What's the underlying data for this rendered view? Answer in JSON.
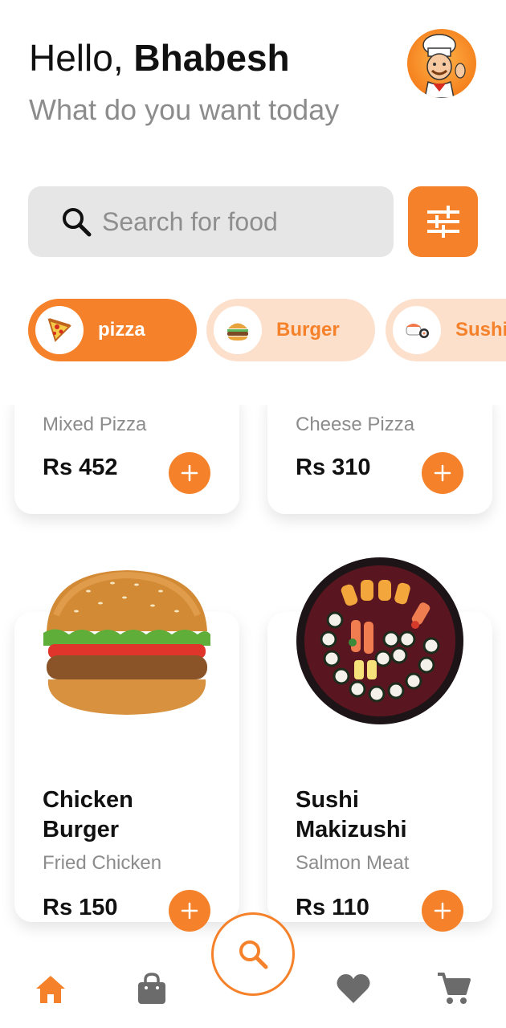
{
  "header": {
    "greeting": "Hello,",
    "user_name": "Bhabesh",
    "subtitle": "What do you want today"
  },
  "avatar": {
    "icon": "chef-avatar"
  },
  "search": {
    "placeholder": "Search for food",
    "icon": "search-icon"
  },
  "filter": {
    "icon": "sliders-icon"
  },
  "categories": [
    {
      "label": "pizza",
      "icon": "pizza-icon",
      "active": true
    },
    {
      "label": "Burger",
      "icon": "burger-icon",
      "active": false
    },
    {
      "label": "Sushi",
      "icon": "sushi-icon",
      "active": false
    }
  ],
  "foods": [
    {
      "subtitle": "Mixed Pizza",
      "price": "Rs 452"
    },
    {
      "subtitle": "Cheese Pizza",
      "price": "Rs 310"
    },
    {
      "name_line1": "Chicken",
      "name_line2": "Burger",
      "subtitle": "Fried Chicken",
      "price": "Rs 150",
      "image": "burger-image"
    },
    {
      "name_line1": "Sushi",
      "name_line2": "Makizushi",
      "subtitle": "Salmon Meat",
      "price": "Rs 110",
      "image": "sushi-platter-image"
    }
  ],
  "nav": [
    {
      "icon": "home-icon",
      "active": true
    },
    {
      "icon": "shopping-bag-icon",
      "active": false
    },
    {
      "icon": "search-icon",
      "active": false
    },
    {
      "icon": "heart-icon",
      "active": false
    },
    {
      "icon": "cart-icon",
      "active": false
    }
  ],
  "colors": {
    "accent": "#f5822a",
    "accent_light": "#fde0cc",
    "muted_text": "#8c8c8c",
    "search_bg": "#e6e6e6",
    "nav_inactive": "#6b6b6b"
  }
}
